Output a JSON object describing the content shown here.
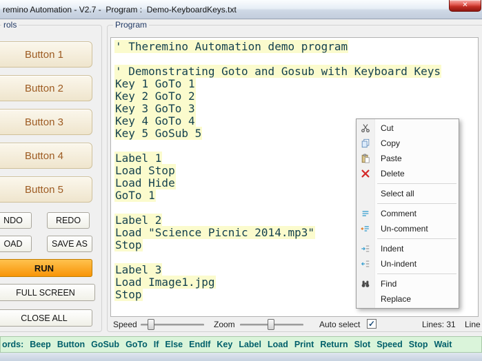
{
  "window": {
    "title": "remino Automation - V2.7 -  Program :  Demo-KeyboardKeys.txt",
    "close_glyph": "✕"
  },
  "colors": {
    "run_orange": "#f89406",
    "code_text": "#123f4d",
    "line_highlight": "#fbfbcd",
    "keywords_teal": "#005f6a",
    "button_brown": "#9d5b22"
  },
  "controls_panel": {
    "label": "rols",
    "big_buttons": [
      "Button 1",
      "Button 2",
      "Button 3",
      "Button 4",
      "Button 5"
    ],
    "undo_label": "NDO",
    "redo_label": "REDO",
    "load_label": "OAD",
    "save_as_label": "SAVE AS",
    "run_label": "RUN",
    "full_screen_label": "FULL SCREEN",
    "close_all_label": "CLOSE ALL"
  },
  "program_panel": {
    "label": "Program",
    "code_lines": [
      "' Theremino Automation demo program",
      "",
      "' Demonstrating Goto and Gosub with Keyboard Keys",
      "Key 1 GoTo 1",
      "Key 2 GoTo 2",
      "Key 3 GoTo 3",
      "Key 4 GoTo 4",
      "Key 5 GoSub 5",
      "",
      "Label 1",
      "Load Stop",
      "Load Hide",
      "GoTo 1",
      "",
      "Label 2",
      "Load \"Science Picnic 2014.mp3\"",
      "Stop",
      "",
      "Label 3",
      "Load Image1.jpg",
      "Stop"
    ],
    "footer": {
      "speed_label": "Speed",
      "zoom_label": "Zoom",
      "auto_select_label": "Auto select",
      "auto_select_checked": true,
      "lines_value": "Lines: 31",
      "line_label": "Line"
    }
  },
  "context_menu": {
    "items": [
      {
        "label": "Cut",
        "icon": "scissors-icon"
      },
      {
        "label": "Copy",
        "icon": "copy-icon"
      },
      {
        "label": "Paste",
        "icon": "paste-icon"
      },
      {
        "label": "Delete",
        "icon": "delete-icon"
      },
      {
        "separator": true
      },
      {
        "label": "Select all"
      },
      {
        "separator": true
      },
      {
        "label": "Comment",
        "icon": "comment-icon"
      },
      {
        "label": "Un-comment",
        "icon": "uncomment-icon"
      },
      {
        "separator": true
      },
      {
        "label": "Indent",
        "icon": "indent-icon"
      },
      {
        "label": "Un-indent",
        "icon": "unindent-icon"
      },
      {
        "separator": true
      },
      {
        "label": "Find",
        "icon": "find-icon"
      },
      {
        "label": "Replace"
      }
    ]
  },
  "keywords_bar": {
    "prefix": "ords:",
    "keywords": [
      "Beep",
      "Button",
      "GoSub",
      "GoTo",
      "If",
      "Else",
      "EndIf",
      "Key",
      "Label",
      "Load",
      "Print",
      "Return",
      "Slot",
      "Speed",
      "Stop",
      "Wait"
    ]
  }
}
